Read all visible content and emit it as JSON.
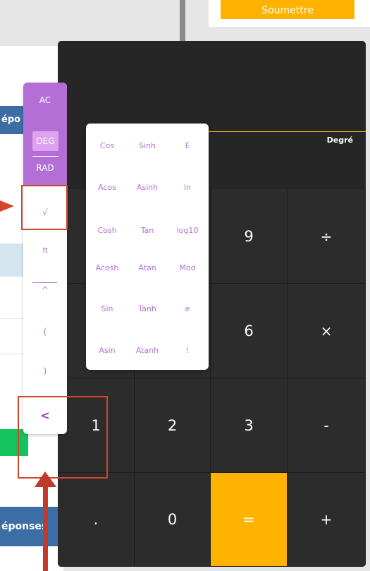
{
  "background": {
    "submit_label": "Soumettre",
    "panel_label_top": "épo",
    "panel_label_bottom": "éponses"
  },
  "calculator": {
    "mode_label": "Degré",
    "keys": {
      "k9": "9",
      "divide": "÷",
      "k6": "6",
      "multiply": "×",
      "k1": "1",
      "k2": "2",
      "k3": "3",
      "minus": "-",
      "dot": ".",
      "k0": "0",
      "equals": "=",
      "plus": "+"
    }
  },
  "side_panel": {
    "ac": "AC",
    "deg": "DEG",
    "rad": "RAD",
    "sqrt": "√",
    "pi": "π",
    "power": "^",
    "open_paren": "(",
    "close_paren": ")",
    "back": "<"
  },
  "functions": [
    "Cos",
    "Sinh",
    "E",
    "Acos",
    "Asinh",
    "ln",
    "Cosh",
    "Tan",
    "log10",
    "Acosh",
    "Atan",
    "Mod",
    "Sin",
    "Tanh",
    "e",
    "Asin",
    "Atanh",
    "!"
  ],
  "colors": {
    "accent_purple": "#b36fd6",
    "accent_orange": "#ffb300",
    "calc_bg": "#262626",
    "annotation_red": "#d0472a"
  }
}
